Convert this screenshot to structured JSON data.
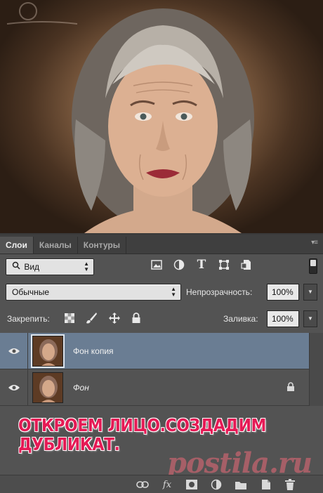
{
  "panel": {
    "tabs": [
      {
        "label": "Слои",
        "active": true
      },
      {
        "label": "Каналы",
        "active": false
      },
      {
        "label": "Контуры",
        "active": false
      }
    ],
    "menu_icon": "panel-menu-icon",
    "filter": {
      "value": "Вид",
      "icon": "search-icon"
    },
    "filter_icons": [
      "image-layer-icon",
      "adjustment-layer-icon",
      "type-layer-icon",
      "shape-layer-icon",
      "smart-object-icon"
    ],
    "blend_mode": "Обычные",
    "opacity_label": "Непрозрачность:",
    "opacity_value": "100%",
    "lock_label": "Закрепить:",
    "lock_icons": [
      "lock-transparent-icon",
      "lock-paint-icon",
      "lock-position-icon",
      "lock-all-icon"
    ],
    "fill_label": "Заливка:",
    "fill_value": "100%",
    "layers": [
      {
        "name": "Фон копия",
        "selected": true,
        "visible": true
      },
      {
        "name": "Фон",
        "selected": false,
        "visible": true,
        "locked": true
      }
    ],
    "bottom_icons": [
      "link-icon",
      "fx-icon",
      "mask-icon",
      "adjustment-icon",
      "folder-icon",
      "new-layer-icon",
      "trash-icon"
    ],
    "fx_label": "fx"
  },
  "caption": {
    "line1": "ОТКРОЕМ ЛИЦО.СОЗДАДИМ",
    "line2": "ДУБЛИКАТ."
  },
  "watermark": "postila.ru",
  "colors": {
    "panel_bg": "#535353",
    "selected_layer": "#6a7d93",
    "caption": "#e51a55"
  }
}
